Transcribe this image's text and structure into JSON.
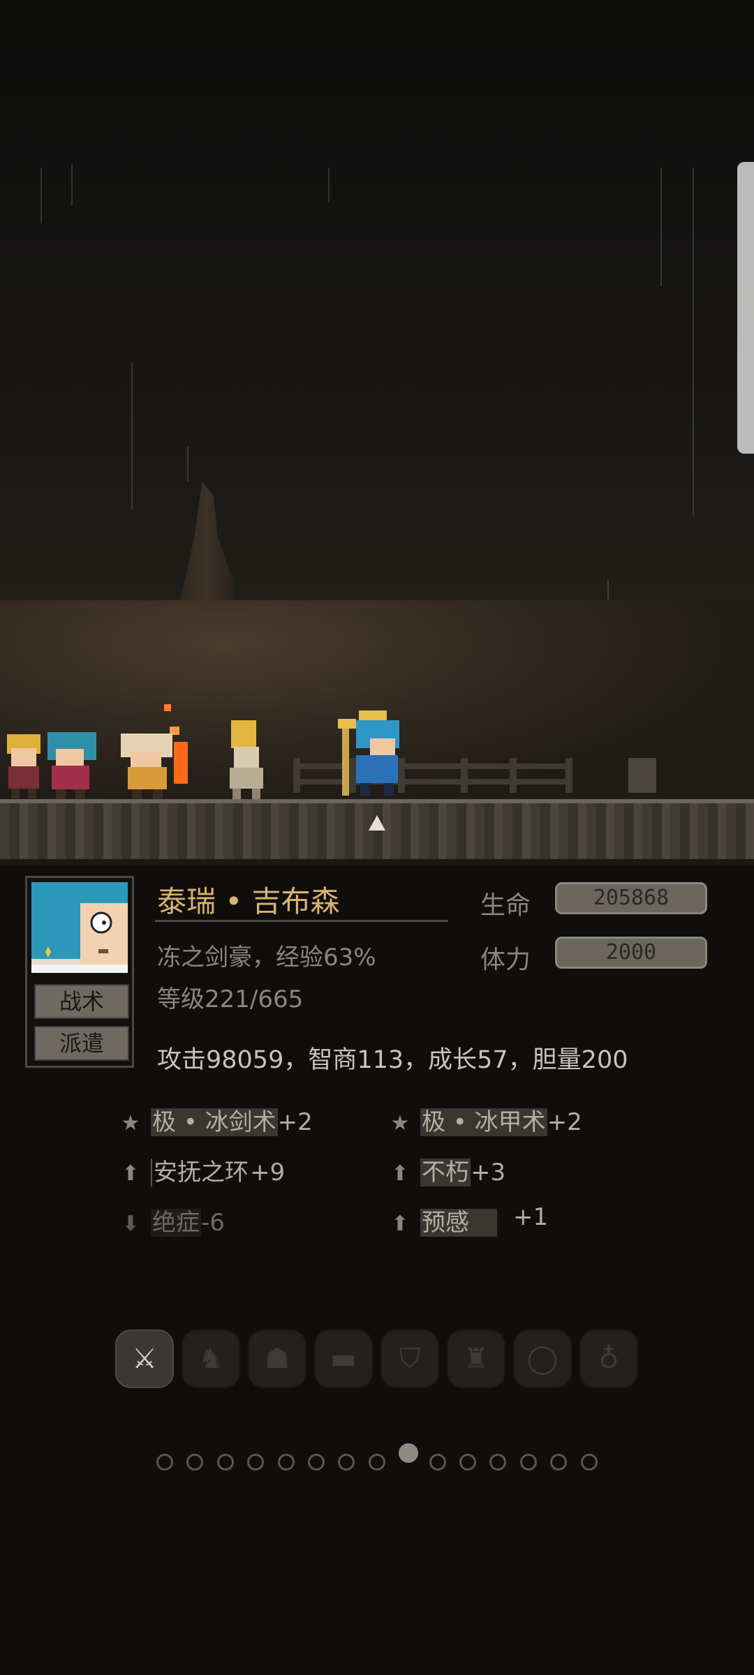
{
  "hero": {
    "name": "泰瑞 • 吉布森",
    "title": "冻之剑豪，经验63%",
    "level": "等级221/665",
    "stats": "攻击98059，智商113，成长57，胆量200",
    "hp_label": "生命",
    "hp_value": "205868",
    "stamina_label": "体力",
    "stamina_value": "2000"
  },
  "portrait_buttons": {
    "tactics": "战术",
    "dispatch": "派遣"
  },
  "skills": {
    "left": [
      {
        "icon": "star-icon",
        "name": "极 • 冰剑术",
        "bonus": "+2"
      },
      {
        "icon": "arrow-up-icon",
        "name": "安抚之环",
        "bonus": "+9"
      },
      {
        "icon": "arrow-down-icon",
        "name": "绝症",
        "bonus": "-6"
      }
    ],
    "right": [
      {
        "icon": "star-icon",
        "name": "极 • 冰甲术",
        "bonus": "+2"
      },
      {
        "icon": "arrow-up-icon",
        "name": "不朽",
        "bonus": "+3"
      },
      {
        "icon": "arrow-up-icon",
        "name": "预感",
        "bonus": "+1"
      }
    ]
  },
  "equipment_slots": [
    "sword-icon",
    "boot-icon",
    "helmet-icon",
    "tank-icon",
    "shield-icon",
    "armor-icon",
    "ring-icon",
    "potion-icon"
  ],
  "pagination": {
    "total": 15,
    "active_index": 8
  },
  "colors": {
    "accent": "#d9b36c",
    "text": "#a9a39a",
    "bar_fill": "#6c675e"
  }
}
